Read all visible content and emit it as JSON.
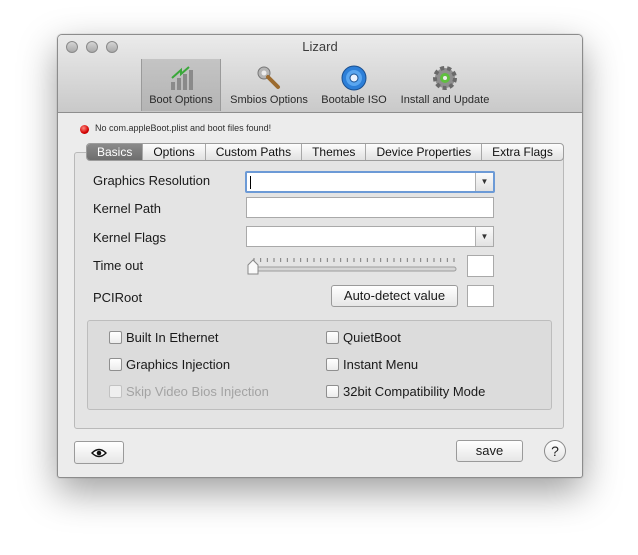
{
  "window": {
    "title": "Lizard"
  },
  "toolbar": {
    "items": [
      {
        "label": "Boot Options",
        "icon": "boot-options-icon",
        "active": true
      },
      {
        "label": "Smbios Options",
        "icon": "wrench-icon",
        "active": false
      },
      {
        "label": "Bootable ISO",
        "icon": "disc-icon",
        "active": false
      },
      {
        "label": "Install and Update",
        "icon": "gear-icon",
        "active": false
      }
    ]
  },
  "status": {
    "message": "No com.appleBoot.plist and boot files found!",
    "color": "#d30000"
  },
  "tabs": [
    "Basics",
    "Options",
    "Custom Paths",
    "Themes",
    "Device Properties",
    "Extra Flags"
  ],
  "selected_tab": "Basics",
  "form": {
    "graphics_resolution_label": "Graphics Resolution",
    "graphics_resolution_value": "",
    "kernel_path_label": "Kernel Path",
    "kernel_path_value": "",
    "kernel_flags_label": "Kernel Flags",
    "kernel_flags_value": "",
    "timeout_label": "Time out",
    "timeout_value": "",
    "timeout_slider_fraction": 0,
    "pciroot_label": "PCIRoot",
    "pciroot_button": "Auto-detect value",
    "pciroot_value": ""
  },
  "checkboxes": {
    "built_in_ethernet": {
      "label": "Built In Ethernet",
      "checked": false,
      "enabled": true
    },
    "graphics_injection": {
      "label": "Graphics Injection",
      "checked": false,
      "enabled": true
    },
    "skip_video_bios": {
      "label": "Skip Video Bios Injection",
      "checked": false,
      "enabled": false
    },
    "quiet_boot": {
      "label": "QuietBoot",
      "checked": false,
      "enabled": true
    },
    "instant_menu": {
      "label": "Instant Menu",
      "checked": false,
      "enabled": true
    },
    "compat_32bit": {
      "label": "32bit Compatibility Mode",
      "checked": false,
      "enabled": true
    }
  },
  "footer": {
    "save_label": "save",
    "help_label": "?",
    "preview_icon": "eye-icon"
  }
}
